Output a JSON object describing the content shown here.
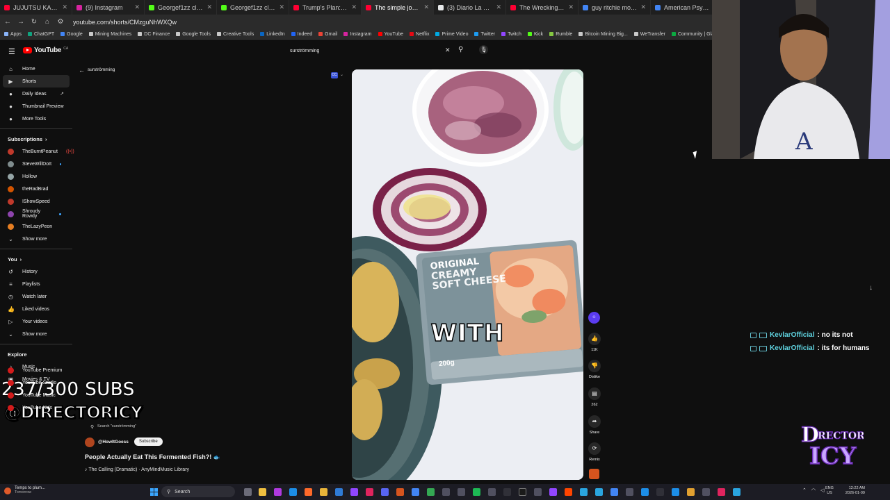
{
  "browser": {
    "tabs": [
      {
        "title": "JUJUTSU KAISEN The Cull",
        "color": "#ff0033",
        "active": false
      },
      {
        "title": "(9) Instagram",
        "color": "#d6249f",
        "active": false
      },
      {
        "title": "Georgef1zz clipped by be",
        "color": "#53fc18",
        "active": false
      },
      {
        "title": "Georgef1zz clipped by bo",
        "color": "#53fc18",
        "active": false
      },
      {
        "title": "Trump's Plan: MAKE OIL C",
        "color": "#ff0033",
        "active": false
      },
      {
        "title": "The simple joy of being a",
        "color": "#ff0033",
        "active": true
      },
      {
        "title": "(3) Diario La Gaceta on X",
        "color": "#e7e9ea",
        "active": false
      },
      {
        "title": "The Wrecking Crew - Offi",
        "color": "#ff0033",
        "active": false
      },
      {
        "title": "guy ritchie movies - Goog",
        "color": "#4285f4",
        "active": false
      },
      {
        "title": "American Psycho",
        "color": "#4285f4",
        "active": false
      }
    ],
    "url": "youtube.com/shorts/CMzguNhWXQw",
    "bookmarks": [
      {
        "label": "Apps",
        "color": "#8ab4f8"
      },
      {
        "label": "ChatGPT",
        "color": "#10a37f"
      },
      {
        "label": "Google",
        "color": "#4285f4"
      },
      {
        "label": "Mining Machines",
        "color": "#c9c9c9"
      },
      {
        "label": "DC Finance",
        "color": "#c9c9c9"
      },
      {
        "label": "Google Tools",
        "color": "#c9c9c9"
      },
      {
        "label": "Creative Tools",
        "color": "#c9c9c9"
      },
      {
        "label": "LinkedIn",
        "color": "#0a66c2"
      },
      {
        "label": "Indeed",
        "color": "#2164f3"
      },
      {
        "label": "Gmail",
        "color": "#ea4335"
      },
      {
        "label": "Instagram",
        "color": "#d6249f"
      },
      {
        "label": "YouTube",
        "color": "#ff0000"
      },
      {
        "label": "Netflix",
        "color": "#e50914"
      },
      {
        "label": "Prime Video",
        "color": "#00a8e1"
      },
      {
        "label": "Twitter",
        "color": "#1d9bf0"
      },
      {
        "label": "Twitch",
        "color": "#9146ff"
      },
      {
        "label": "Kick",
        "color": "#53fc18"
      },
      {
        "label": "Rumble",
        "color": "#85c742"
      },
      {
        "label": "Bitcoin Mining Big...",
        "color": "#c9c9c9"
      },
      {
        "label": "WeTransfer",
        "color": "#c9c9c9"
      },
      {
        "label": "Community | Glassd...",
        "color": "#0caa41"
      }
    ]
  },
  "youtube": {
    "logo_text": "YouTube",
    "logo_region": "CA",
    "search_query": "surströmming",
    "back_query": "surströmming",
    "sidebar": {
      "main": [
        {
          "label": "Home",
          "icon": "⌂",
          "active": false
        },
        {
          "label": "Shorts",
          "icon": "▶",
          "active": true
        },
        {
          "label": "Daily Ideas",
          "icon": "●",
          "active": false,
          "external": true
        },
        {
          "label": "Thumbnail Preview",
          "icon": "●",
          "active": false
        },
        {
          "label": "More Tools",
          "icon": "●",
          "active": false
        }
      ],
      "subscriptions_title": "Subscriptions",
      "subscriptions": [
        {
          "label": "TheBurntPeanut",
          "color": "#c0392b",
          "indicator": "new"
        },
        {
          "label": "SteveWillDoIt",
          "color": "#7f8c8d",
          "indicator": "live"
        },
        {
          "label": "Hollow",
          "color": "#95a5a6",
          "indicator": ""
        },
        {
          "label": "theRadBrad",
          "color": "#d35400",
          "indicator": ""
        },
        {
          "label": "IShowSpeed",
          "color": "#c0392b",
          "indicator": ""
        },
        {
          "label": "Shroudy Rowdy",
          "color": "#8e44ad",
          "indicator": "live"
        },
        {
          "label": "TheLazyPeon",
          "color": "#e67e22",
          "indicator": ""
        }
      ],
      "show_more": "Show more",
      "you_title": "You",
      "you": [
        {
          "label": "History",
          "icon": "↺"
        },
        {
          "label": "Playlists",
          "icon": "≡"
        },
        {
          "label": "Watch later",
          "icon": "◷"
        },
        {
          "label": "Liked videos",
          "icon": "👍"
        },
        {
          "label": "Your videos",
          "icon": "▷"
        }
      ],
      "explore_title": "Explore",
      "explore": [
        {
          "label": "Music",
          "icon": "♪"
        },
        {
          "label": "Movies & TV",
          "icon": "▣"
        }
      ],
      "more_from": [
        {
          "label": "YouTube Premium"
        },
        {
          "label": "YouTube Studio"
        },
        {
          "label": "YouTube Music"
        },
        {
          "label": "YouTube Kids"
        }
      ]
    },
    "short": {
      "caption": "WITH",
      "pack_line1": "ORIGINAL",
      "pack_line2": "CREAMY",
      "pack_line3": "SOFT CHEESE",
      "pack_weight": "200g",
      "search_hint": "Search \"surströmming\"",
      "channel": "@HowItGoess",
      "subscribe_label": "Subscribe",
      "title": "People Actually Eat This Fermented Fish?!",
      "title_emoji": "🐟",
      "music": "♪ The Calling (Dramatic) · AnyMindMusic Library",
      "likes": "11K",
      "dislike_label": "Dislike",
      "comments": "262",
      "share_label": "Share",
      "remix_label": "Remix"
    }
  },
  "overlay": {
    "subs_counter": "237/300 SUBS",
    "handle": "@DIRECTORICY",
    "chat": [
      {
        "user": "KevlarOfficial",
        "message": ": no its not"
      },
      {
        "user": "KevlarOfficial",
        "message": ": its for humans"
      }
    ]
  },
  "taskbar": {
    "weather_line1": "Temps to plum...",
    "weather_line2": "Tomorrow",
    "search_label": "Search",
    "lang_line1": "ENG",
    "lang_line2": "US",
    "time": "12:22 AM",
    "date": "2026-01-09"
  }
}
